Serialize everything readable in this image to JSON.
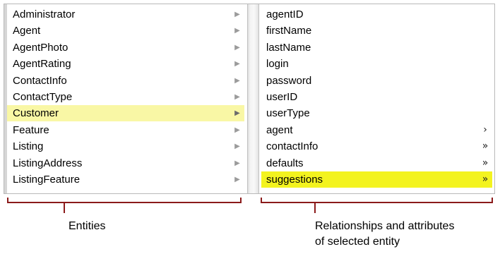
{
  "entities_column": {
    "items": [
      {
        "label": "Administrator"
      },
      {
        "label": "Agent"
      },
      {
        "label": "AgentPhoto"
      },
      {
        "label": "AgentRating"
      },
      {
        "label": "ContactInfo"
      },
      {
        "label": "ContactType"
      },
      {
        "label": "Customer",
        "selected": true
      },
      {
        "label": "Feature"
      },
      {
        "label": "Listing"
      },
      {
        "label": "ListingAddress"
      },
      {
        "label": "ListingFeature"
      }
    ],
    "arrow_glyph": "▶"
  },
  "properties_column": {
    "items": [
      {
        "label": "agentID",
        "glyph": ""
      },
      {
        "label": "firstName",
        "glyph": ""
      },
      {
        "label": "lastName",
        "glyph": ""
      },
      {
        "label": "login",
        "glyph": ""
      },
      {
        "label": "password",
        "glyph": ""
      },
      {
        "label": "userID",
        "glyph": ""
      },
      {
        "label": "userType",
        "glyph": ""
      },
      {
        "label": "agent",
        "glyph": "›"
      },
      {
        "label": "contactInfo",
        "glyph": "»"
      },
      {
        "label": "defaults",
        "glyph": "»"
      },
      {
        "label": "suggestions",
        "glyph": "»",
        "selected": true
      }
    ]
  },
  "annotations": {
    "entities_caption": "Entities",
    "relationships_caption_line1": "Relationships and attributes",
    "relationships_caption_line2": "of selected entity"
  },
  "colors": {
    "selected_entity_bg": "#f9f7a5",
    "selected_property_bg": "#f3f31f",
    "bracket": "#8b1a1a"
  }
}
